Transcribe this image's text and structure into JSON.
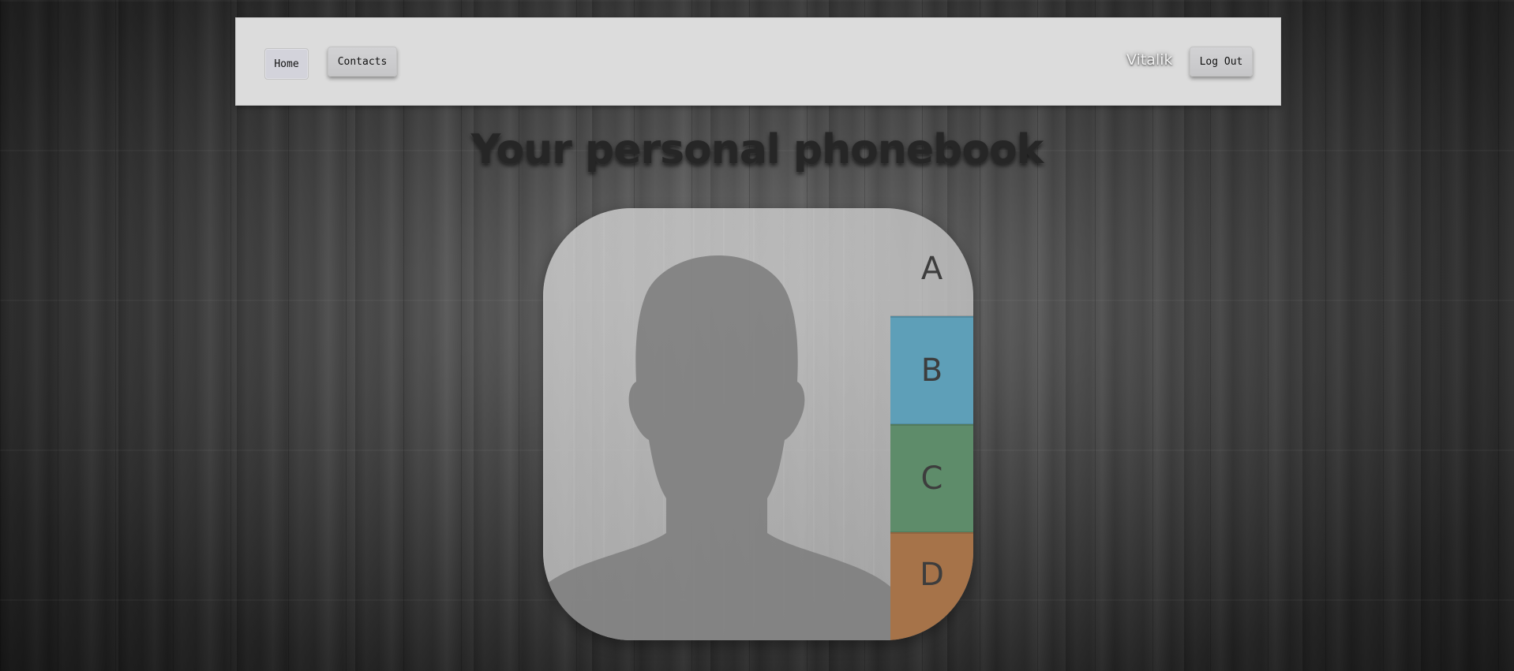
{
  "navbar": {
    "home_label": "Home",
    "contacts_label": "Contacts",
    "username": "Vitalik",
    "logout_label": "Log Out"
  },
  "hero": {
    "title": "Your personal phonebook"
  },
  "phonebook_icon": {
    "tabs": [
      {
        "letter": "A",
        "color": "#cdcdcd"
      },
      {
        "letter": "B",
        "color": "#5e9fb8"
      },
      {
        "letter": "C",
        "color": "#5e8c6a"
      },
      {
        "letter": "D",
        "color": "#a67349"
      }
    ]
  }
}
